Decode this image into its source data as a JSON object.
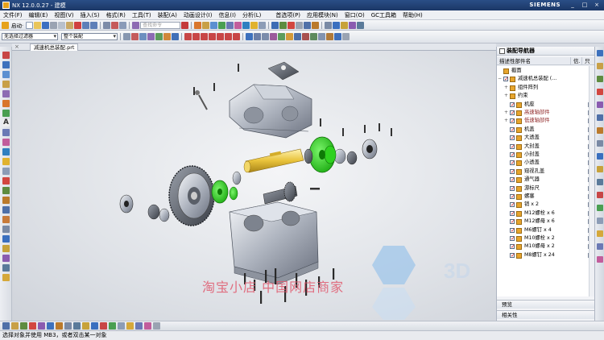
{
  "window": {
    "title": "NX 12.0.0.27 - 建模",
    "brand": "SIEMENS",
    "buttons": [
      "_",
      "□",
      "×"
    ]
  },
  "menu": [
    "文件(F)",
    "编辑(E)",
    "视图(V)",
    "插入(S)",
    "格式(R)",
    "工具(T)",
    "装配(A)",
    "动画设计(I)",
    "信息(I)",
    "分析(L)",
    "首选项(P)",
    "应用模块(N)",
    "窗口(O)",
    "GC工具箱",
    "帮助(H)"
  ],
  "toolbar": {
    "start_label": "启动·",
    "search_placeholder": "查找命令"
  },
  "selection": {
    "filter_value": "无选择过滤器",
    "scope_value": "整个装配"
  },
  "file_tab": {
    "label": "减速机总装配.prt",
    "close": "×"
  },
  "navigator": {
    "title": "装配导航器",
    "col_name": "描述性部件名",
    "col_info": "信.",
    "col_other": "只",
    "rows": [
      {
        "label": "截面",
        "indent": 0,
        "kind": "section"
      },
      {
        "label": "减速机总装配 (...",
        "indent": 0,
        "kind": "root"
      },
      {
        "label": "组件阵列",
        "indent": 1,
        "kind": "group"
      },
      {
        "label": "约束",
        "indent": 1,
        "kind": "group"
      },
      {
        "label": "机座",
        "indent": 1,
        "kind": "part"
      },
      {
        "label": "高速轴部件",
        "indent": 1,
        "kind": "sub"
      },
      {
        "label": "低速轴部件",
        "indent": 1,
        "kind": "sub"
      },
      {
        "label": "机盖",
        "indent": 1,
        "kind": "part"
      },
      {
        "label": "大透盖",
        "indent": 1,
        "kind": "part"
      },
      {
        "label": "大封盖",
        "indent": 1,
        "kind": "part"
      },
      {
        "label": "小封盖",
        "indent": 1,
        "kind": "part"
      },
      {
        "label": "小透盖",
        "indent": 1,
        "kind": "part"
      },
      {
        "label": "窥视孔盖",
        "indent": 1,
        "kind": "part"
      },
      {
        "label": "通气器",
        "indent": 1,
        "kind": "part"
      },
      {
        "label": "游标尺",
        "indent": 1,
        "kind": "part"
      },
      {
        "label": "螺塞",
        "indent": 1,
        "kind": "part"
      },
      {
        "label": "销 x 2",
        "indent": 1,
        "kind": "part"
      },
      {
        "label": "M12螺栓 x 6",
        "indent": 1,
        "kind": "part"
      },
      {
        "label": "M12螺母 x 6",
        "indent": 1,
        "kind": "part"
      },
      {
        "label": "M6螺钉 x 4",
        "indent": 1,
        "kind": "part"
      },
      {
        "label": "M10螺栓 x 2",
        "indent": 1,
        "kind": "part"
      },
      {
        "label": "M10螺母 x 2",
        "indent": 1,
        "kind": "part"
      },
      {
        "label": "M8螺钉 x 24",
        "indent": 1,
        "kind": "part"
      }
    ],
    "preview_label": "预览",
    "dependencies_label": "相关性"
  },
  "watermark": {
    "text": "淘宝小店 中国网店商家"
  },
  "status": {
    "prompt": "选择对象并使用 MB3，或者双击某一对象"
  },
  "colors": {
    "title_bar": "#1f3f73",
    "green_part": "#22c414",
    "shaft": "#e8c23a",
    "checkmark": "#c8101c"
  }
}
